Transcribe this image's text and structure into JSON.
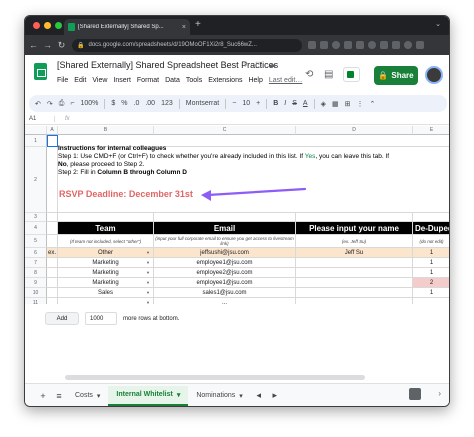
{
  "browser": {
    "tab_title": "[Shared Externally] Shared Sp...",
    "tab_close": "×",
    "new_tab": "+",
    "url": "docs.google.com/spreadsheets/d/19OMoOF1Xi2r8_Suc66wZ...",
    "traffic_colors": [
      "#ff5f57",
      "#febc2e",
      "#28c840"
    ]
  },
  "doc": {
    "title": "[Shared Externally] Shared Spreadsheet Best Practices",
    "menu": [
      "File",
      "Edit",
      "View",
      "Insert",
      "Format",
      "Data",
      "Tools",
      "Extensions",
      "Help"
    ],
    "last_edit": "Last edit…",
    "share_label": "Share"
  },
  "toolbar": {
    "zoom": "100%",
    "currency": "$",
    "percent": "%",
    "dec_less": ".0",
    "dec_more": ".00",
    "format_123": "123",
    "font": "Montserrat",
    "font_size": "10",
    "bold": "B",
    "italic": "I",
    "strike": "S",
    "text_color": "A"
  },
  "formula_bar": {
    "cell_ref": "A1",
    "fx": "fx"
  },
  "columns": [
    "A",
    "B",
    "C",
    "D",
    "E"
  ],
  "rows": [
    "1",
    "2",
    "3",
    "4",
    "5",
    "6",
    "7",
    "8",
    "9",
    "10",
    "11"
  ],
  "instructions": {
    "heading": "Instructions for internal colleagues",
    "step1_a": "Step 1: Use CMD+F (or Ctrl+F) to check whether you're already included in this list. If ",
    "step1_yes": "Yes",
    "step1_b": ", you can leave this tab. If",
    "step1_no": "No",
    "step1_c": ", please proceed to Step 2.",
    "step2_a": "Step 2: Fill in ",
    "step2_b": "Column B through Column D",
    "rsvp": "RSVP Deadline: December 31st"
  },
  "table": {
    "headers": [
      "Team",
      "Email",
      "Please input your name",
      "De-Duped"
    ],
    "subheaders": [
      "(If team not included, select \"other\")",
      "(input your full corporate email to ensure you get access to livestream link)",
      "(ex. Jeff Su)",
      "(do not edit)"
    ],
    "example_label": "ex.",
    "rows": [
      {
        "team": "Other",
        "email": "jeffsushi@jsu.com",
        "name": "Jeff Su",
        "dedup": "1"
      },
      {
        "team": "Marketing",
        "email": "employee1@jsu.com",
        "name": "",
        "dedup": "1"
      },
      {
        "team": "Marketing",
        "email": "employee2@jsu.com",
        "name": "",
        "dedup": "1"
      },
      {
        "team": "Marketing",
        "email": "employee1@jsu.com",
        "name": "",
        "dedup": "2"
      },
      {
        "team": "Sales",
        "email": "sales1@jsu.com",
        "name": "",
        "dedup": "1"
      },
      {
        "team": "",
        "email": "...",
        "name": "",
        "dedup": ""
      }
    ]
  },
  "add_rows": {
    "button": "Add",
    "count": "1000",
    "suffix": "more rows at bottom."
  },
  "sheets": {
    "tabs": [
      "Costs",
      "Internal Whitelist",
      "Nominations"
    ],
    "active_index": 1
  },
  "colors": {
    "accent": "#188038",
    "rsvp": "#e06666",
    "arrow": "#8e5cf6",
    "example_row": "#fce5cd",
    "duplicate": "#f4cccc"
  }
}
